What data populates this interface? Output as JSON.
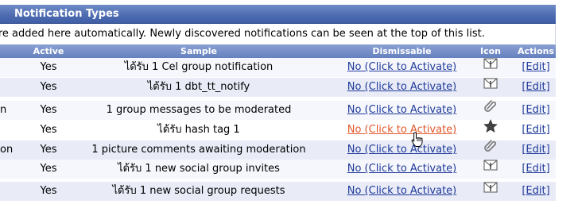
{
  "panel": {
    "title": "Notification Types",
    "description": "ypes are added here automatically. Newly discovered notifications can be seen at the top of this list."
  },
  "columns": {
    "active": "Active",
    "sample": "Sample",
    "dismissable": "Dismissable",
    "icon": "Icon",
    "actions": "Actions"
  },
  "rows": [
    {
      "name": "",
      "active": "Yes",
      "sample": "ได้รับ 1 Cel group notification",
      "dismissable": "No (Click to Activate)",
      "icon": "envelope-icon",
      "action": "[Edit]"
    },
    {
      "name": "",
      "active": "Yes",
      "sample": "ได้รับ 1 dbt_tt_notify",
      "dismissable": "No (Click to Activate)",
      "icon": "envelope-icon",
      "action": "[Edit]"
    },
    {
      "name": "n",
      "active": "Yes",
      "sample": "1 group messages to be moderated",
      "dismissable": "No (Click to Activate)",
      "icon": "paperclip-icon",
      "action": "[Edit]"
    },
    {
      "name": "",
      "active": "Yes",
      "sample": "ได้รับ hash tag 1",
      "dismissable": "No (Click to Activate)",
      "icon": "star-icon",
      "action": "[Edit]"
    },
    {
      "name": "on",
      "active": "Yes",
      "sample": "1 picture comments awaiting moderation",
      "dismissable": "No (Click to Activate)",
      "icon": "paperclip-icon",
      "action": "[Edit]"
    },
    {
      "name": "",
      "active": "Yes",
      "sample": "ได้รับ 1 new social group invites",
      "dismissable": "No (Click to Activate)",
      "icon": "envelope-icon",
      "action": "[Edit]"
    },
    {
      "name": "",
      "active": "Yes",
      "sample": "ได้รับ 1 new social group requests",
      "dismissable": "No (Click to Activate)",
      "icon": "envelope-icon",
      "action": "[Edit]"
    }
  ],
  "colors": {
    "header_bg": "#4f6db1",
    "link": "#1f3a9a",
    "link_hover": "#e2582a"
  }
}
